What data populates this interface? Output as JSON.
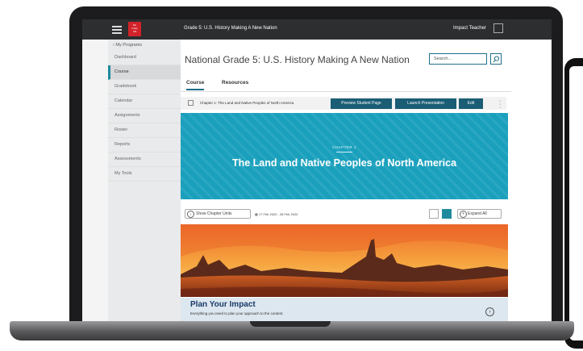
{
  "topbar": {
    "app_title": "Grade 5: U.S. History Making A New Nation",
    "user_name": "Impact Teacher",
    "logo_text": "Mc Graw Hill"
  },
  "sidebar": {
    "back_label": "‹ My Programs",
    "items": [
      {
        "label": "Dashboard"
      },
      {
        "label": "Course"
      },
      {
        "label": "Gradebook"
      },
      {
        "label": "Calendar"
      },
      {
        "label": "Assignments"
      },
      {
        "label": "Roster"
      },
      {
        "label": "Reports"
      },
      {
        "label": "Assessments"
      },
      {
        "label": "My Tools"
      }
    ]
  },
  "main": {
    "course_title": "National Grade 5: U.S. History Making A New Nation",
    "search_placeholder": "Search...",
    "tabs": [
      {
        "label": "Course"
      },
      {
        "label": "Resources"
      }
    ],
    "chapter_label": "Chapter 1: The Land and Native Peoples of North America",
    "buttons": {
      "preview": "Preview Student Page",
      "launch": "Launch Presentation",
      "edit": "Edit"
    },
    "hero": {
      "kicker": "CHAPTER 1",
      "title": "The Land and Native Peoples of North America"
    },
    "show_units_label": "Show Chapter Units",
    "date_range": "17 Feb 2020 - 28 Feb 2020",
    "expand_all_label": "Expand All",
    "impact": {
      "title": "Plan Your Impact",
      "subtitle": "Everything you need to plan your approach to the content."
    }
  },
  "colors": {
    "accent": "#1f8a9e",
    "hero": "#1aa0bd",
    "button": "#1a5d75",
    "topbar": "#2c2e30"
  }
}
